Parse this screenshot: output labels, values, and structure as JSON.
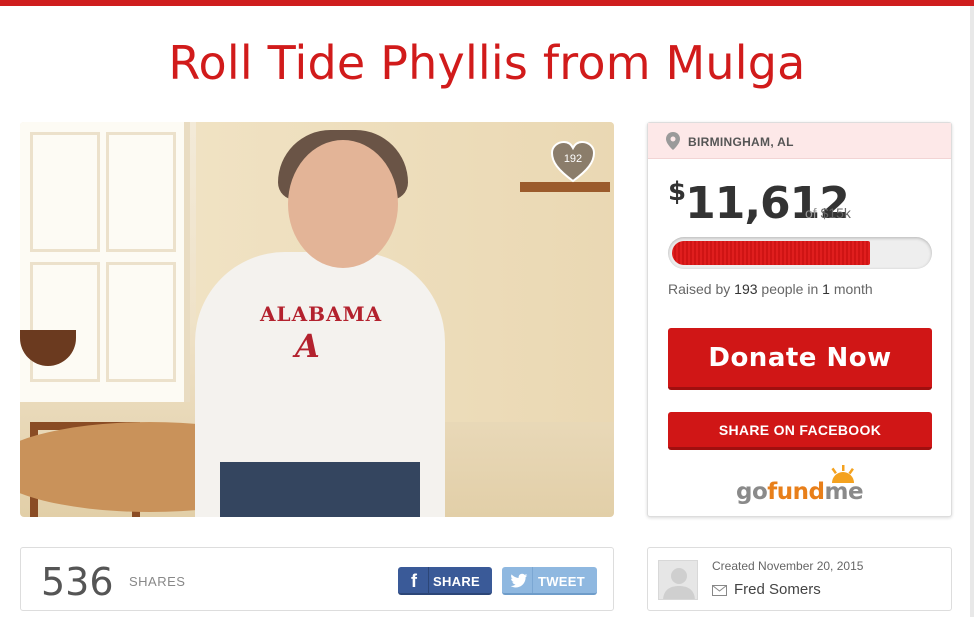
{
  "campaign": {
    "title": "Roll Tide Phyllis from Mulga",
    "photo_alt": "Woman in Alabama hoodie sitting at kitchen table",
    "photo_shirt_text": "ALABAMA",
    "photo_shirt_letter": "A",
    "hearts": "192"
  },
  "card": {
    "location": "BIRMINGHAM, AL",
    "currency": "$",
    "raised_amount": "11,612",
    "goal_prefix": "of",
    "goal": "$15k",
    "progress_fraction": 0.774,
    "raised_by_prefix": "Raised by",
    "donor_count": "193",
    "people_in": "people in",
    "duration_num": "1",
    "duration_unit": "month",
    "donate_label": "Donate Now",
    "share_facebook_label": "SHARE ON FACEBOOK",
    "logo_go": "go",
    "logo_fund": "fund",
    "logo_me": "me"
  },
  "shares": {
    "count": "536",
    "label": "SHARES",
    "fb_icon": "f",
    "fb_label": "SHARE",
    "tweet_label": "TWEET"
  },
  "organizer": {
    "created": "Created November 20, 2015",
    "name": "Fred Somers"
  },
  "colors": {
    "brand_red": "#d01616",
    "facebook_blue": "#3a5a98",
    "twitter_blue": "#8fb8e0",
    "gofundme_orange": "#e87f1a"
  }
}
